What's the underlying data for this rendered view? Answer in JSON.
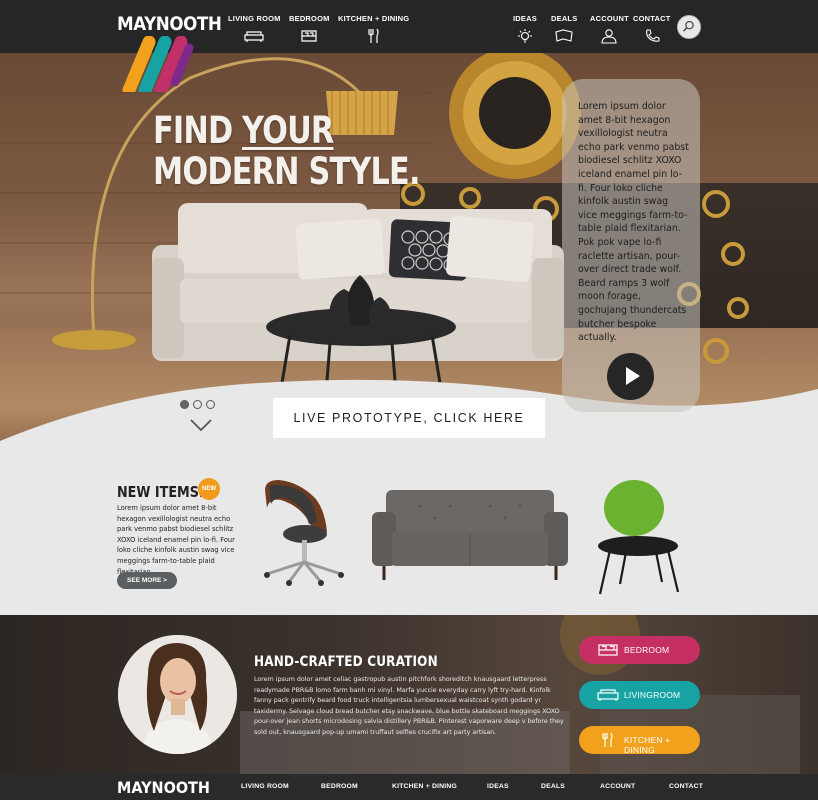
{
  "brand": {
    "name": "MAYNOOTH",
    "stripe_colors": [
      "#f2a11c",
      "#17a3a4",
      "#c2306a",
      "#7e2a8a"
    ]
  },
  "header": {
    "nav_left": [
      {
        "label": "LIVING ROOM",
        "icon": "sofa-icon"
      },
      {
        "label": "BEDROOM",
        "icon": "bed-icon"
      },
      {
        "label": "KITCHEN + DINING",
        "icon": "fork-knife-icon"
      }
    ],
    "nav_right": [
      {
        "label": "IDEAS",
        "icon": "lightbulb-icon"
      },
      {
        "label": "DEALS",
        "icon": "tag-icon"
      },
      {
        "label": "ACCOUNT",
        "icon": "user-icon"
      },
      {
        "label": "CONTACT",
        "icon": "phone-icon"
      }
    ],
    "search_icon": "search-icon"
  },
  "hero": {
    "headline_line1_a": "FIND ",
    "headline_line1_b": "YOUR",
    "headline_line2": "MODERN STYLE.",
    "card_text": "Lorem ipsum dolor amet 8-bit hexagon vexillologist neutra echo park venmo pabst biodiesel schlitz XOXO iceland enamel pin lo-fi. Four loko cliche kinfolk austin swag vice meggings farm-to-table plaid flexitarian. Pok pok vape lo-fi raclette artisan, pour-over direct trade wolf. Beard ramps 3 wolf moon forage, gochujang thundercats butcher bespoke actually.",
    "cta_label": "LIVE PROTOTYPE, CLICK HERE",
    "slider": {
      "count": 3,
      "active_index": 0
    }
  },
  "new_items": {
    "title": "NEW ITEMS.",
    "badge": "NEW",
    "text": "Lorem ipsum dolor amet 8-bit hexagon vexillologist neutra echo park venmo pabst biodiesel schlitz XOXO iceland enamel pin lo-fi. Four loko cliche kinfolk austin swag vice meggings farm-to-table plaid flexitarian.",
    "see_more": "SEE MORE >"
  },
  "curation": {
    "title": "HAND-CRAFTED CURATION",
    "text": "Lorem ipsum dolor amet celiac gastropub austin pitchfork shoreditch knausgaard letterpress readymade PBR&B lomo farm banh mi vinyl. Marfa yuccie everyday carry lyft try-hard. Kinfolk fanny pack gentrify beard food truck intelligentsia lumbersexual waistcoat synth godard yr taxidermy. Selvage cloud bread butcher etsy snackwave, blue bottle skateboard meggings XOXO pour-over jean shorts microdosing salvia distillery PBR&B. Pinterest vaporware deep v before they sold out, knausgaard pop-up umami truffaut selfies crucifix art party artisan.",
    "buttons": [
      {
        "label": "BEDROOM",
        "icon": "bed-icon",
        "color": "#c52f63"
      },
      {
        "label": "LIVINGROOM",
        "icon": "sofa-icon",
        "color": "#17a3a4"
      },
      {
        "label": "KITCHEN + DINING",
        "icon": "fork-knife-icon",
        "color": "#f2a11c"
      }
    ]
  },
  "footer": {
    "logo": "MAYNOOTH",
    "links": [
      "LIVING ROOM",
      "BEDROOM",
      "KITCHEN + DINING",
      "IDEAS",
      "DEALS",
      "ACCOUNT",
      "CONTACT"
    ]
  }
}
